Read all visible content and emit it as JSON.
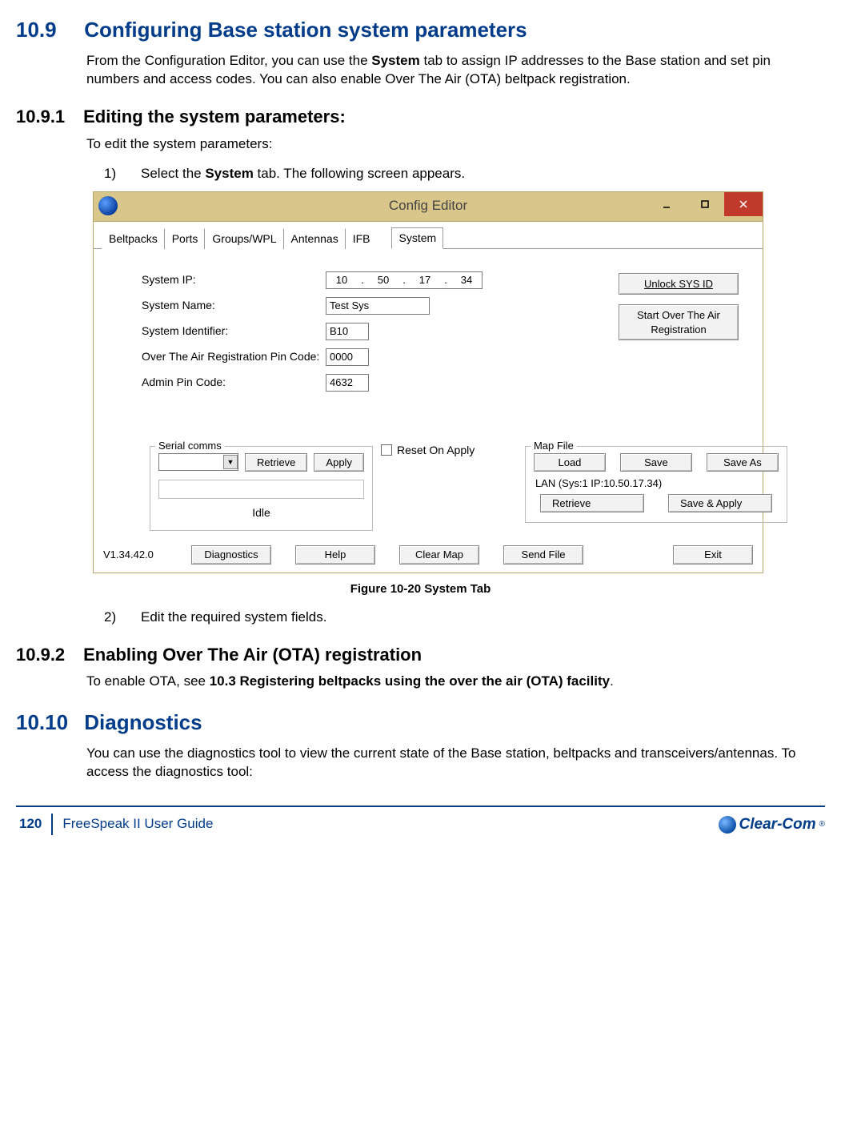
{
  "section_10_9": {
    "num": "10.9",
    "title": "Configuring Base station system parameters",
    "intro_a": "From the Configuration Editor, you can use the ",
    "intro_bold": "System",
    "intro_b": " tab to assign IP addresses to the Base station and set pin numbers and access codes. You can also enable Over The Air (OTA) beltpack registration."
  },
  "section_10_9_1": {
    "num": "10.9.1",
    "title": "Editing the system parameters:",
    "lead": "To edit the system parameters:",
    "step1_num": "1)",
    "step1_a": "Select the ",
    "step1_bold": "System",
    "step1_b": " tab. The following screen appears.",
    "step2_num": "2)",
    "step2_txt": "Edit the required system fields."
  },
  "window": {
    "title": "Config Editor",
    "tabs": [
      "Beltpacks",
      "Ports",
      "Groups/WPL",
      "Antennas",
      "IFB",
      "System"
    ],
    "active_tab_index": 5,
    "labels": {
      "system_ip": "System IP:",
      "system_name": "System Name:",
      "system_identifier": "System Identifier:",
      "ota_pin": "Over The Air Registration Pin Code:",
      "admin_pin": "Admin Pin Code:"
    },
    "values": {
      "ip": [
        "10",
        "50",
        "17",
        "34"
      ],
      "system_name": "Test Sys",
      "system_identifier": "B10",
      "ota_pin": "0000",
      "admin_pin": "4632"
    },
    "buttons": {
      "unlock": "Unlock SYS ID",
      "start_ota": "Start Over The Air Registration",
      "retrieve": "Retrieve",
      "apply": "Apply",
      "load": "Load",
      "save": "Save",
      "save_as": "Save As",
      "retrieve2": "Retrieve",
      "save_apply": "Save & Apply",
      "diagnostics": "Diagnostics",
      "help": "Help",
      "clear_map": "Clear Map",
      "send_file": "Send File",
      "exit": "Exit"
    },
    "serial_legend": "Serial comms",
    "serial_idle": "Idle",
    "reset_on_apply": "Reset On Apply",
    "mapfile_legend": "Map File",
    "lan_line": "LAN  (Sys:1 IP:10.50.17.34)",
    "version": "V1.34.42.0"
  },
  "figure_caption": "Figure 10-20 System Tab",
  "section_10_9_2": {
    "num": "10.9.2",
    "title": "Enabling Over The Air (OTA) registration",
    "body_a": "To enable OTA, see ",
    "body_bold": "10.3 Registering beltpacks using the over the air (OTA) facility",
    "body_b": "."
  },
  "section_10_10": {
    "num": "10.10",
    "title": "Diagnostics",
    "body": "You can use the diagnostics tool to view the current state of the Base station, beltpacks and transceivers/antennas. To access the diagnostics tool:"
  },
  "footer": {
    "page": "120",
    "doc": "FreeSpeak II User Guide",
    "brand": "Clear-Com"
  }
}
